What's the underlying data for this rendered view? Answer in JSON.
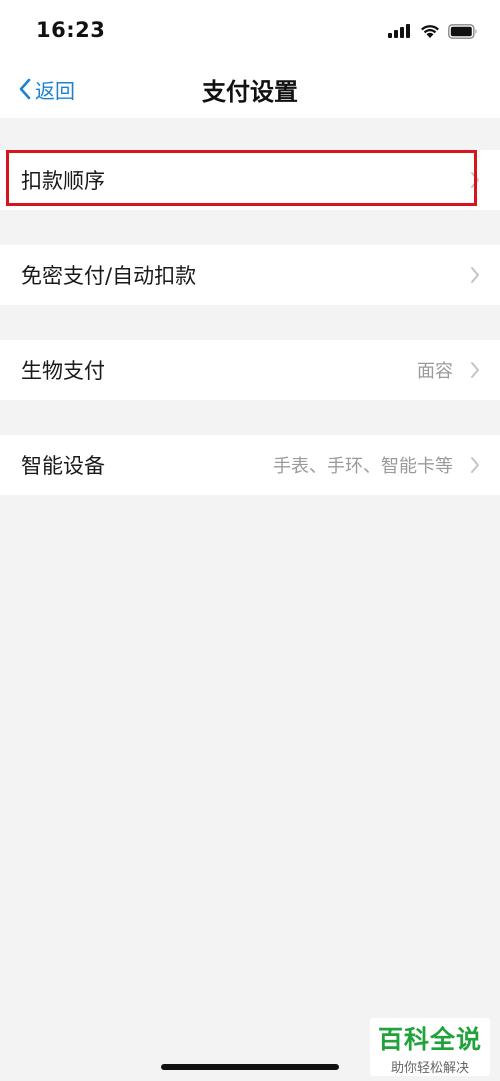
{
  "status_bar": {
    "time": "16:23"
  },
  "nav": {
    "back_label": "返回",
    "title": "支付设置"
  },
  "rows": [
    {
      "label": "扣款顺序",
      "value": ""
    },
    {
      "label": "免密支付/自动扣款",
      "value": ""
    },
    {
      "label": "生物支付",
      "value": "面容"
    },
    {
      "label": "智能设备",
      "value": "手表、手环、智能卡等"
    }
  ],
  "watermark": {
    "brand": "百科全说",
    "slogan": "助你轻松解决"
  },
  "colors": {
    "accent": "#1e82d2",
    "highlight": "#d8141e",
    "watermark": "#20a33a"
  }
}
